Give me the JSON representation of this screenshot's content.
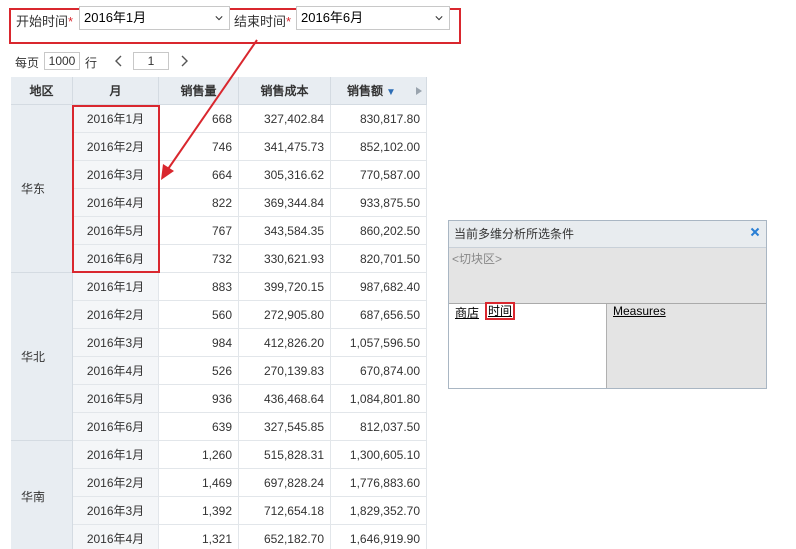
{
  "filter": {
    "start_label": "开始时间",
    "start_value": "2016年1月",
    "end_label": "结束时间",
    "end_value": "2016年6月",
    "required_mark": "*"
  },
  "pager": {
    "per_page_label": "每页",
    "per_page_value": "1000",
    "rows_label": "行",
    "page_value": "1"
  },
  "table": {
    "columns": [
      "地区",
      "月",
      "销售量",
      "销售成本",
      "销售额"
    ],
    "sort_indicator": "▼",
    "regions": [
      {
        "name": "华东",
        "rows": [
          {
            "month": "2016年1月",
            "qty": "668",
            "cost": "327,402.84",
            "sales": "830,817.80"
          },
          {
            "month": "2016年2月",
            "qty": "746",
            "cost": "341,475.73",
            "sales": "852,102.00"
          },
          {
            "month": "2016年3月",
            "qty": "664",
            "cost": "305,316.62",
            "sales": "770,587.00"
          },
          {
            "month": "2016年4月",
            "qty": "822",
            "cost": "369,344.84",
            "sales": "933,875.50"
          },
          {
            "month": "2016年5月",
            "qty": "767",
            "cost": "343,584.35",
            "sales": "860,202.50"
          },
          {
            "month": "2016年6月",
            "qty": "732",
            "cost": "330,621.93",
            "sales": "820,701.50"
          }
        ]
      },
      {
        "name": "华北",
        "rows": [
          {
            "month": "2016年1月",
            "qty": "883",
            "cost": "399,720.15",
            "sales": "987,682.40"
          },
          {
            "month": "2016年2月",
            "qty": "560",
            "cost": "272,905.80",
            "sales": "687,656.50"
          },
          {
            "month": "2016年3月",
            "qty": "984",
            "cost": "412,826.20",
            "sales": "1,057,596.50"
          },
          {
            "month": "2016年4月",
            "qty": "526",
            "cost": "270,139.83",
            "sales": "670,874.00"
          },
          {
            "month": "2016年5月",
            "qty": "936",
            "cost": "436,468.64",
            "sales": "1,084,801.80"
          },
          {
            "month": "2016年6月",
            "qty": "639",
            "cost": "327,545.85",
            "sales": "812,037.50"
          }
        ]
      },
      {
        "name": "华南",
        "rows": [
          {
            "month": "2016年1月",
            "qty": "1,260",
            "cost": "515,828.31",
            "sales": "1,300,605.10"
          },
          {
            "month": "2016年2月",
            "qty": "1,469",
            "cost": "697,828.24",
            "sales": "1,776,883.60"
          },
          {
            "month": "2016年3月",
            "qty": "1,392",
            "cost": "712,654.18",
            "sales": "1,829,352.70"
          },
          {
            "month": "2016年4月",
            "qty": "1,321",
            "cost": "652,182.70",
            "sales": "1,646,919.90"
          }
        ]
      }
    ]
  },
  "panel": {
    "title": "当前多维分析所选条件",
    "slice_placeholder": "<切块区>",
    "row_dims": [
      "商店",
      "时间"
    ],
    "col_dims": [
      "Measures"
    ]
  },
  "colors": {
    "highlight": "#d9272e",
    "header_bg": "#e8edf2"
  }
}
